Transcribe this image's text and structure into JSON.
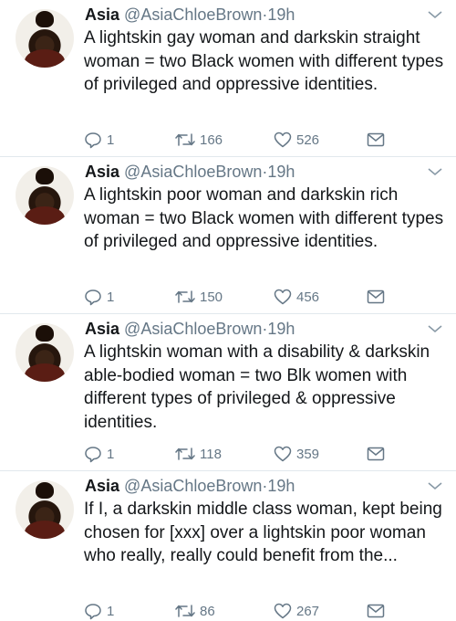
{
  "tweets": [
    {
      "name": "Asia",
      "handle": "@AsiaChloeBrown",
      "separator": "·",
      "time": "19h",
      "text": "A lightskin gay woman and darkskin straight woman = two Black women with different types of privileged and oppressive identities.",
      "replies": "1",
      "retweets": "166",
      "likes": "526"
    },
    {
      "name": "Asia",
      "handle": "@AsiaChloeBrown",
      "separator": "·",
      "time": "19h",
      "text": "A lightskin poor woman and darkskin rich woman = two Black women with different types of privileged and oppressive identities.",
      "replies": "1",
      "retweets": "150",
      "likes": "456"
    },
    {
      "name": "Asia",
      "handle": "@AsiaChloeBrown",
      "separator": "·",
      "time": "19h",
      "text": "A lightskin woman with a disability & darkskin able-bodied woman = two Blk women with different types of privileged & oppressive identities.",
      "replies": "1",
      "retweets": "118",
      "likes": "359"
    },
    {
      "name": "Asia",
      "handle": "@AsiaChloeBrown",
      "separator": "·",
      "time": "19h",
      "text": "If I, a darkskin middle class woman, kept being chosen for [xxx] over a lightskin poor woman who really, really could benefit from the...",
      "replies": "1",
      "retweets": "86",
      "likes": "267"
    }
  ],
  "colors": {
    "text": "#14171a",
    "secondary": "#657786",
    "divider": "#e1e8ed"
  },
  "icons": [
    "reply-icon",
    "retweet-icon",
    "like-icon",
    "message-icon",
    "chevron-down-icon"
  ]
}
